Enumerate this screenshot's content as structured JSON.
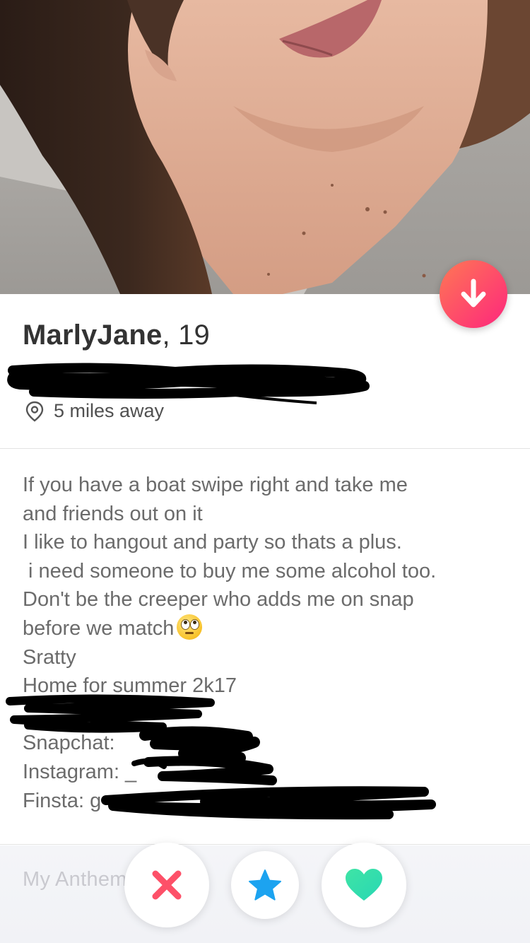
{
  "profile": {
    "name": "MarlyJane",
    "age": ", 19",
    "distance": "5 miles away"
  },
  "bio": {
    "lines": [
      "If you have a boat swipe right and take me",
      "and friends out on it",
      "I like to hangout and party so thats a plus.",
      " i need someone to buy me some alcohol too.",
      "Don't be the creeper who adds me on snap",
      "before we match",
      "Sratty",
      "Home for summer 2k17",
      "",
      "Snapchat: ",
      "Instagram: _",
      "Finsta: g"
    ]
  },
  "anthem_label": "My Anthem",
  "icons": {
    "down": "arrow-down-icon",
    "pin": "location-pin-icon",
    "nope": "x-icon",
    "super": "star-icon",
    "like": "heart-icon",
    "emoji": "eye-roll-emoji"
  },
  "colors": {
    "accent_gradient_start": "#ff7854",
    "accent_gradient_end": "#fd267d",
    "nope": "#fd5068",
    "super_like": "#1ca3f0",
    "like": "#3fe4a5"
  }
}
